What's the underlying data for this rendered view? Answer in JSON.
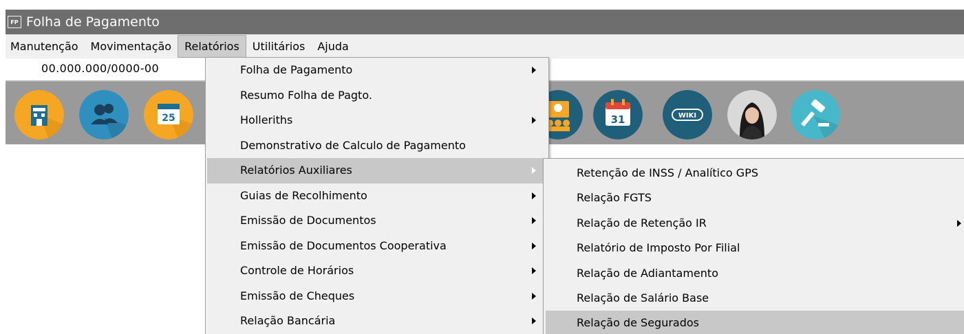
{
  "window": {
    "icon_label": "FP",
    "title": "Folha de Pagamento"
  },
  "menubar": {
    "items": [
      {
        "label": "Manutenção"
      },
      {
        "label": "Movimentação"
      },
      {
        "label": "Relatórios",
        "active": true
      },
      {
        "label": "Utilitários"
      },
      {
        "label": "Ajuda"
      }
    ]
  },
  "company": {
    "cnpj": "00.000.000/0000-00"
  },
  "toolbar": {
    "icons": [
      {
        "name": "company-building-icon",
        "color": "#f5a623"
      },
      {
        "name": "employees-icon",
        "color": "#2f8fbf"
      },
      {
        "name": "calendar-25-icon",
        "color": "#f5a623",
        "text": "25"
      },
      {
        "name": "employee-group-icon",
        "color": "#1f5f7a"
      },
      {
        "name": "calendar-31-icon",
        "color": "#1f5f7a",
        "text": "31"
      },
      {
        "name": "wiki-icon",
        "color": "#1f5f7a",
        "text": "WIKI"
      },
      {
        "name": "assistant-avatar-icon",
        "color": "#d9d9d9"
      },
      {
        "name": "gavel-icon",
        "color": "#47b8c9"
      }
    ]
  },
  "relatorios_menu": {
    "items": [
      {
        "label": "Folha de Pagamento",
        "has_submenu": true
      },
      {
        "label": "Resumo Folha de Pagto.",
        "has_submenu": false
      },
      {
        "label": "Holleriths",
        "has_submenu": true
      },
      {
        "label": "Demonstrativo de Calculo de Pagamento",
        "has_submenu": false
      },
      {
        "label": "Relatórios Auxiliares",
        "has_submenu": true,
        "highlighted": true
      },
      {
        "label": "Guias de Recolhimento",
        "has_submenu": true
      },
      {
        "label": "Emissão de Documentos",
        "has_submenu": true
      },
      {
        "label": "Emissão de Documentos Cooperativa",
        "has_submenu": true
      },
      {
        "label": "Controle de Horários",
        "has_submenu": true
      },
      {
        "label": "Emissão de Cheques",
        "has_submenu": true
      },
      {
        "label": "Relação Bancária",
        "has_submenu": true
      }
    ]
  },
  "auxiliares_submenu": {
    "items": [
      {
        "label": "Retenção de INSS / Analítico GPS",
        "has_submenu": false
      },
      {
        "label": "Relação FGTS",
        "has_submenu": false
      },
      {
        "label": "Relação de Retenção IR",
        "has_submenu": true
      },
      {
        "label": "Relatório de Imposto Por Filial",
        "has_submenu": false
      },
      {
        "label": "Relação de Adiantamento",
        "has_submenu": false
      },
      {
        "label": "Relação de Salário Base",
        "has_submenu": false
      },
      {
        "label": "Relação de Segurados",
        "has_submenu": false,
        "highlighted": true
      }
    ]
  },
  "colors": {
    "titlebar": "#6e6e6e",
    "menubar": "#f0f0f0",
    "toolbar": "#9a9a9a",
    "highlight": "#c8c8c8"
  }
}
